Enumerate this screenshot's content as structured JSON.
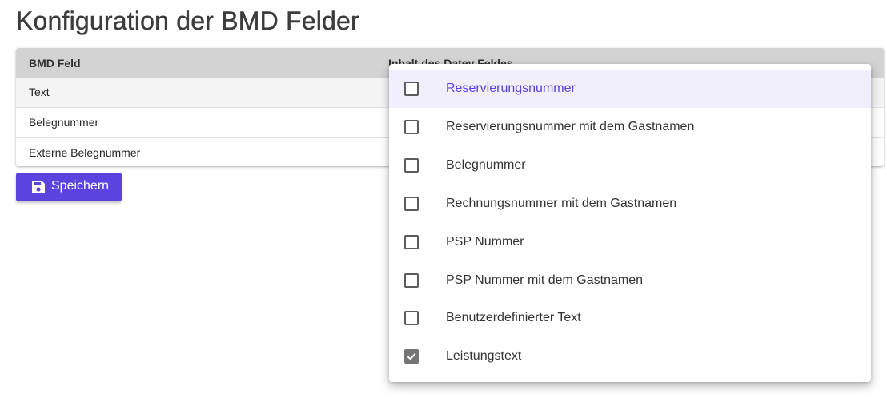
{
  "page": {
    "title": "Konfiguration der BMD Felder"
  },
  "table": {
    "headers": [
      "BMD Feld",
      "Inhalt des Datev Feldes"
    ],
    "rows": [
      "Text",
      "Belegnummer",
      "Externe Belegnummer"
    ]
  },
  "actions": {
    "save_label": "Speichern",
    "save_icon": "floppy-disk-icon"
  },
  "dropdown": {
    "options": [
      {
        "label": "Reservierungsnummer",
        "checked": false,
        "highlighted": true
      },
      {
        "label": "Reservierungsnummer mit dem Gastnamen",
        "checked": false
      },
      {
        "label": "Belegnummer",
        "checked": false
      },
      {
        "label": "Rechnungsnummer mit dem Gastnamen",
        "checked": false
      },
      {
        "label": "PSP Nummer",
        "checked": false
      },
      {
        "label": "PSP Nummer mit dem Gastnamen",
        "checked": false
      },
      {
        "label": "Benutzerdefinierter Text",
        "checked": false
      },
      {
        "label": "Leistungstext",
        "checked": true
      }
    ]
  },
  "colors": {
    "accent": "#5b43e0",
    "header_bg": "#d3d3d3",
    "highlight_bg": "#f1effc"
  }
}
